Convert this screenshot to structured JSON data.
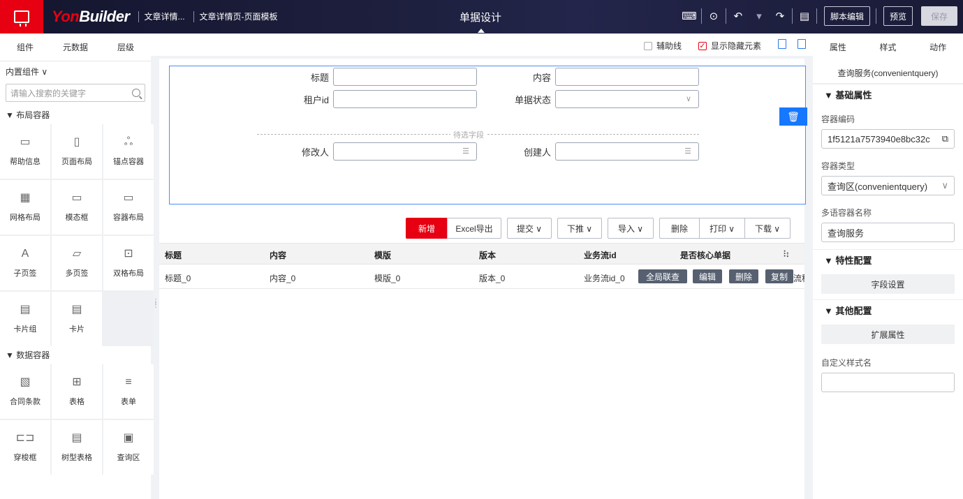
{
  "header": {
    "brand_yon": "Yon",
    "brand_builder": "Builder",
    "crumb1": "文章详情...",
    "crumb2": "文章详情页-页面模板",
    "title": "单据设计",
    "script_edit": "脚本编辑",
    "preview": "预览",
    "save": "保存"
  },
  "left": {
    "tabs": [
      "组件",
      "元数据",
      "层级"
    ],
    "builtin": "内置组件 ∨",
    "search_placeholder": "请输入搜索的关键字",
    "layout_group": "▼ 布局容器",
    "layout_items": [
      {
        "label": "帮助信息",
        "icon": "▭"
      },
      {
        "label": "页面布局",
        "icon": "▯"
      },
      {
        "label": "锚点容器",
        "icon": "ஃ"
      },
      {
        "label": "网格布局",
        "icon": "▦"
      },
      {
        "label": "模态框",
        "icon": "▭"
      },
      {
        "label": "容器布局",
        "icon": "▭"
      },
      {
        "label": "子页签",
        "icon": "A"
      },
      {
        "label": "多页签",
        "icon": "▱"
      },
      {
        "label": "双格布局",
        "icon": "⊡"
      },
      {
        "label": "卡片组",
        "icon": "▤"
      },
      {
        "label": "卡片",
        "icon": "▤"
      }
    ],
    "data_group": "▼ 数据容器",
    "data_items": [
      {
        "label": "合同条款",
        "icon": "▧"
      },
      {
        "label": "表格",
        "icon": "⊞"
      },
      {
        "label": "表单",
        "icon": "≡"
      },
      {
        "label": "穿梭框",
        "icon": "⊏⊐"
      },
      {
        "label": "树型表格",
        "icon": "▤"
      },
      {
        "label": "查询区",
        "icon": "▣"
      }
    ]
  },
  "canvas": {
    "guide_lines": "辅助线",
    "show_hidden": "显示隐藏元素",
    "fields": {
      "title": "标题",
      "content": "内容",
      "tenant": "租户id",
      "status": "单据状态",
      "modifier": "修改人",
      "creator": "创建人"
    },
    "pending": "待选字段",
    "buttons": {
      "add": "新增",
      "excel": "Excel导出",
      "submit": "提交 ∨",
      "push": "下推 ∨",
      "import": "导入 ∨",
      "delete": "删除",
      "print": "打印 ∨",
      "download": "下载 ∨"
    },
    "columns": [
      "标题",
      "内容",
      "模版",
      "版本",
      "业务流id",
      "是否核心单据"
    ],
    "row": [
      "标题_0",
      "内容_0",
      "模版_0",
      "版本_0",
      "业务流id_0"
    ],
    "row_actions": [
      "全局联查",
      "编辑",
      "删除",
      "复制"
    ],
    "row_tail": "流程"
  },
  "right": {
    "tabs": [
      "属性",
      "样式",
      "动作"
    ],
    "subtitle": "查询服务(convenientquery)",
    "basic": "▼ 基础属性",
    "code_label": "容器编码",
    "code_value": "1f5121a7573940e8bc32c",
    "type_label": "容器类型",
    "type_value": "查询区(convenientquery)",
    "name_label": "多语容器名称",
    "name_value": "查询服务",
    "feature": "▼ 特性配置",
    "field_setting": "字段设置",
    "other": "▼ 其他配置",
    "ext": "扩展属性",
    "style_label": "自定义样式名"
  }
}
